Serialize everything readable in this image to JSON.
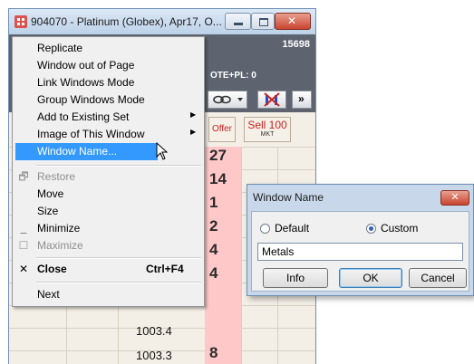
{
  "window": {
    "title": "904070 - Platinum (Globex), Apr17, O...",
    "header_number": "15698",
    "ote_label": "OTE+PL: 0",
    "more_tool": "»",
    "offer_label": "Offer",
    "sell_label": "Sell 100",
    "sell_sub": "MKT"
  },
  "grid": {
    "quantities": [
      "27",
      "14",
      "1",
      "2",
      "4",
      "4"
    ],
    "prices": [
      "1003.4",
      "1003.3"
    ],
    "price_qty": "8"
  },
  "menu": {
    "items": [
      {
        "label": "Replicate"
      },
      {
        "label": "Window out of Page"
      },
      {
        "label": "Link Windows Mode"
      },
      {
        "label": "Group Windows Mode"
      },
      {
        "label": "Add to Existing Set"
      },
      {
        "label": "Image of This Window"
      },
      {
        "label": "Window Name..."
      },
      {
        "label": "Restore"
      },
      {
        "label": "Move"
      },
      {
        "label": "Size"
      },
      {
        "label": "Minimize"
      },
      {
        "label": "Maximize"
      },
      {
        "label": "Close",
        "shortcut": "Ctrl+F4"
      },
      {
        "label": "Next"
      }
    ],
    "highlighted": "Window Name...",
    "highlight_color": "#3399ff"
  },
  "dialog": {
    "title": "Window Name",
    "radio_default": "Default",
    "radio_custom": "Custom",
    "selected": "Custom",
    "name_value": "Metals",
    "info_button": "Info",
    "ok_button": "OK",
    "cancel_button": "Cancel"
  },
  "colors": {
    "sell_text": "#c42020",
    "qty_cell": "#ffc8c8",
    "header_bar": "#5d6470"
  },
  "icons": [
    "app-icon",
    "minimize-icon",
    "maximize-icon",
    "close-icon",
    "link-icon",
    "split-icon",
    "restore-icon",
    "minimize-menu-icon",
    "maximize-menu-icon",
    "close-x-icon",
    "mouse-cursor-icon"
  ]
}
